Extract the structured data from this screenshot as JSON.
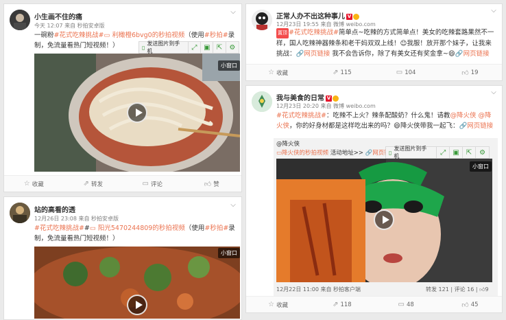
{
  "colors": {
    "link": "#eb7350",
    "background": "#eaeaea",
    "card": "#ffffff"
  },
  "post1": {
    "user": "小生画不住的痛",
    "meta": "今天 12:07 来自 秒拍安卓版",
    "text_plain": "一碗粉",
    "tag": "#花式吃辣挑战#",
    "link": "利橄橙6bvg0的秒拍视频",
    "text_rest": "（使用",
    "app_tag": "#秒拍#",
    "text_end": "录制，免流量看热门短视频！）",
    "send_label": "发送图片到手机",
    "mini_label": "小窗口",
    "actions": [
      "收藏",
      "转发",
      "评论",
      "赞"
    ]
  },
  "post2": {
    "user": "站的高看的透",
    "meta": "12月26日 23:08 来自 秒拍安卓版",
    "tag": "#花式吃辣挑战#",
    "mark": "#",
    "link": "阳光5470244809的秒拍视频",
    "text_rest": "（使用",
    "app_tag": "#秒拍#",
    "text_end": "录制，免流量看热门短视频！）",
    "mini_label": "小窗口"
  },
  "post3": {
    "user": "正常人办不出这种事儿",
    "meta": "12月23日 19:55 来自 微博 weibo.com",
    "hot": "置顶",
    "tag": "#花式吃辣挑战#",
    "text1": "简单点~吃辣的方式简单点！美女的吃辣套路果然不一样，国人吃辣神器辣条和老干妈双双上线！",
    "text2": "我服！放开那个妹子，让我来挑战：",
    "link": "网页链接",
    "text3": "我不会告诉你，除了有美女还有奖金拿~",
    "link2": "网页链接",
    "actions": [
      "收藏",
      "115",
      "104",
      "19"
    ]
  },
  "post4": {
    "user": "我与美食的日常",
    "meta": "12月23日 20:20 来自 微博 weibo.com",
    "tag": "#花式吃辣挑战#",
    "text1": "：吃辣不上火？辣条配酸奶？什么鬼！请教",
    "mention": "降火侠",
    "text2": "@降火侠",
    "text3": "，你的好身材都是这样吃出来的吗？",
    "text4": "降火侠带我一起飞：",
    "link": "网页链接",
    "sub_user": "@降火侠",
    "sub_tag": "降火侠的秒拍视频",
    "sub_text": "活动地址>>",
    "sub_link": "网页链接",
    "send_label": "发送图片到手机",
    "mini_label": "小窗口",
    "footer_time": "12月22日 11:00 来自 秒拍客户端",
    "footer_stats": [
      "转发 121",
      "评论 16",
      "9"
    ],
    "actions": [
      "收藏",
      "118",
      "48",
      "45"
    ]
  }
}
